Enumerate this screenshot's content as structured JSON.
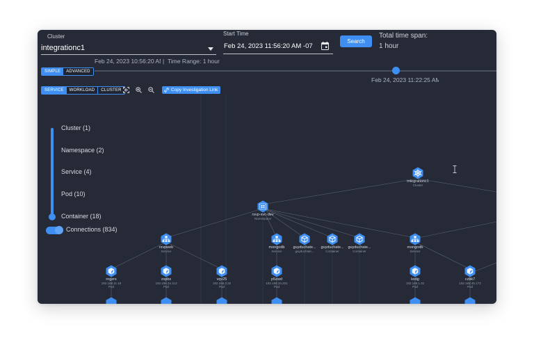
{
  "header": {
    "cluster_label": "Cluster",
    "cluster_value": "integrationc1",
    "start_time_label": "Start Time",
    "start_time_value": "Feb 24, 2023 11:56:20 AM -07:00",
    "search_label": "Search",
    "total_span_label": "Total time span:",
    "total_span_value": "1 hour"
  },
  "timeline": {
    "range_start": "Feb 24, 2023 10:56:20 AM",
    "range_sep": "|",
    "range_label": "Time Range: 1 hour",
    "mode_simple": "SIMPLE",
    "mode_advanced": "ADVANCED",
    "position": 0.75,
    "thumb_time": "Feb 24, 2023 11:22:25 AM"
  },
  "toolbar": {
    "view_service": "SERVICE",
    "view_workload": "WORKLOAD",
    "view_cluster": "CLUSTER",
    "copy_link": "Copy Investigation Link"
  },
  "levels": [
    {
      "label": "Cluster (1)"
    },
    {
      "label": "Namespace (2)"
    },
    {
      "label": "Service (4)"
    },
    {
      "label": "Pod (10)"
    },
    {
      "label": "Container (18)"
    }
  ],
  "connections": {
    "label": "Connections (834)"
  },
  "colors": {
    "accent": "#3f8ff2",
    "background": "#252a36",
    "line": "#5b6270"
  },
  "graph": {
    "nodes": [
      {
        "id": "integ",
        "name": "integrationc1",
        "sub": "Cluster",
        "icon": "helm-icon"
      },
      {
        "id": "ns",
        "name": "rsvp-svc-dev",
        "sub": "Namespace",
        "icon": "namespace-icon"
      },
      {
        "id": "svcweb",
        "name": "rsvpweb",
        "sub": "Service",
        "icon": "service-icon"
      },
      {
        "id": "svcmongo",
        "name": "mongodb",
        "sub": "Service",
        "icon": "service-icon"
      },
      {
        "id": "c1",
        "name": "guyduchate...",
        "sub": "guyduchate...",
        "icon": "container-icon"
      },
      {
        "id": "c2",
        "name": "guyduchate...",
        "sub": "Container",
        "icon": "container-icon"
      },
      {
        "id": "c3",
        "name": "guyduchate...",
        "sub": "Container",
        "icon": "container-icon"
      },
      {
        "id": "svcmongo2",
        "name": "mongodb",
        "sub": "Service",
        "icon": "service-icon"
      },
      {
        "id": "p1",
        "name": "rngzrs",
        "sub": "192.168.11.18",
        "sub2": "Pod",
        "icon": "pod-icon"
      },
      {
        "id": "p2",
        "name": "zxpbs",
        "sub": "192.168.34.113",
        "sub2": "Pod",
        "icon": "pod-icon"
      },
      {
        "id": "p3",
        "name": "vqv25",
        "sub": "192.168.3.26",
        "sub2": "Pod",
        "icon": "pod-icon"
      },
      {
        "id": "p4",
        "name": "p5zwd",
        "sub": "192.168.34.201",
        "sub2": "Pod",
        "icon": "pod-icon"
      },
      {
        "id": "p5",
        "name": "kxdg",
        "sub": "192.168.1.32",
        "sub2": "Pod",
        "icon": "pod-icon"
      },
      {
        "id": "p6",
        "name": "czbk7",
        "sub": "192.168.45.173",
        "sub2": "Pod",
        "icon": "pod-icon"
      }
    ]
  }
}
